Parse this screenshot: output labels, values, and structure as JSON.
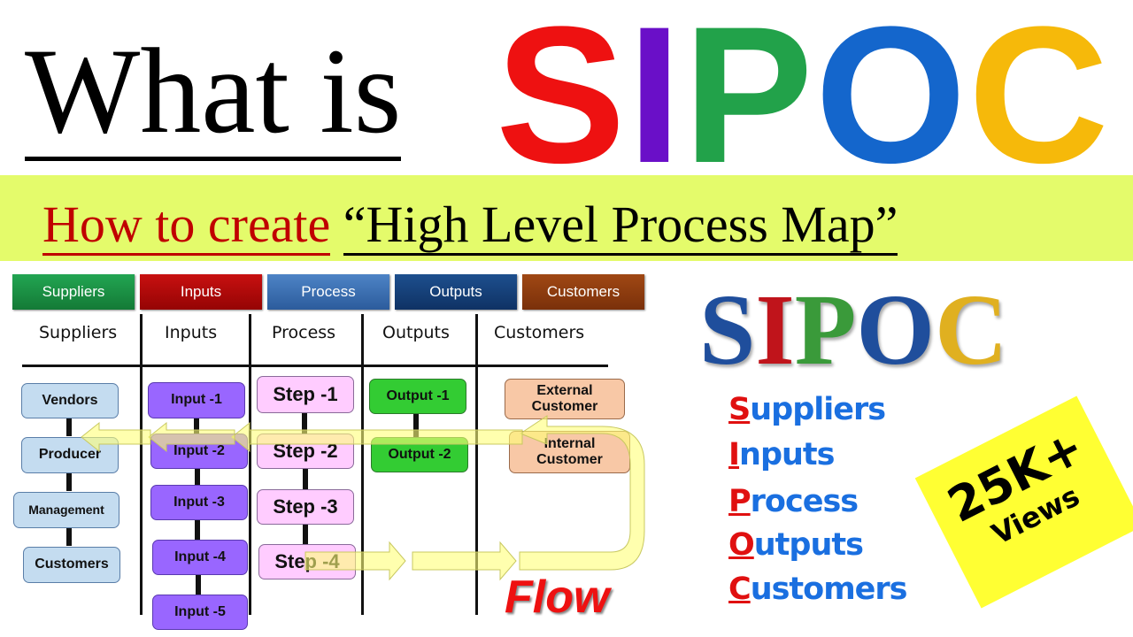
{
  "title": {
    "prefix": "What is",
    "letters": [
      {
        "char": "S",
        "color": "#ee1111"
      },
      {
        "char": "I",
        "color": "#6a0fc8"
      },
      {
        "char": "P",
        "color": "#22a24a"
      },
      {
        "char": "O",
        "color": "#1466cc"
      },
      {
        "char": "C",
        "color": "#f6b90a"
      }
    ]
  },
  "subtitle": {
    "part1": "How to create",
    "part2": "“High Level Process Map”",
    "part1_color": "#c00000"
  },
  "header_bars": [
    {
      "label": "Suppliers",
      "color": "#1d9447"
    },
    {
      "label": "Inputs",
      "color": "#b40808"
    },
    {
      "label": "Process",
      "color": "#3b6fb2"
    },
    {
      "label": "Outputs",
      "color": "#143f7a"
    },
    {
      "label": "Customers",
      "color": "#8a3a0e"
    }
  ],
  "columns": [
    "Suppliers",
    "Inputs",
    "Process",
    "Outputs",
    "Customers"
  ],
  "suppliers": [
    "Vendors",
    "Producer",
    "Management",
    "Customers"
  ],
  "inputs": [
    "Input -1",
    "Input -2",
    "Input -3",
    "Input -4",
    "Input -5"
  ],
  "process": [
    "Step -1",
    "Step -2",
    "Step -3",
    "Step -4"
  ],
  "outputs": [
    "Output -1",
    "Output -2"
  ],
  "customers": [
    "External Customer",
    "Internal Customer"
  ],
  "flow_label": "Flow",
  "logo": {
    "letters": [
      {
        "char": "S",
        "color": "#1f4e9c"
      },
      {
        "char": "I",
        "color": "#c0141b"
      },
      {
        "char": "P",
        "color": "#3a9a3a"
      },
      {
        "char": "O",
        "color": "#1f4e9c"
      },
      {
        "char": "C",
        "color": "#e0b020"
      }
    ]
  },
  "acronym": [
    {
      "initial": "S",
      "rest": "uppliers"
    },
    {
      "initial": "I",
      "rest": "nputs"
    },
    {
      "initial": "P",
      "rest": "rocess"
    },
    {
      "initial": "O",
      "rest": "utputs"
    },
    {
      "initial": "C",
      "rest": "ustomers"
    }
  ],
  "badge": {
    "count": "25K+",
    "label": "Views"
  }
}
